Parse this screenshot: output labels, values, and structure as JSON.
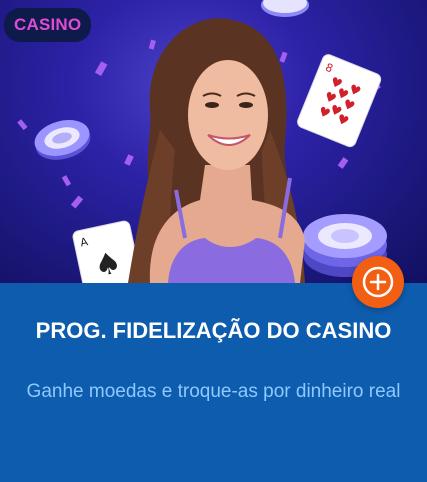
{
  "badge": {
    "label": "CASINO"
  },
  "promo": {
    "title": "PROG. FIDELIZAÇÃO DO CASINO",
    "subtitle": "Ganhe moedas e troque-as por dinheiro real"
  },
  "colors": {
    "badge_text": "#e04bd6",
    "hero_background": "#2d22a8",
    "info_background": "#0e5cad",
    "title_text": "#ffffff",
    "subtitle_text": "#8ec8ff",
    "action_button": "#f25f12"
  },
  "icons": {
    "action_button": "plus-circle-icon"
  }
}
